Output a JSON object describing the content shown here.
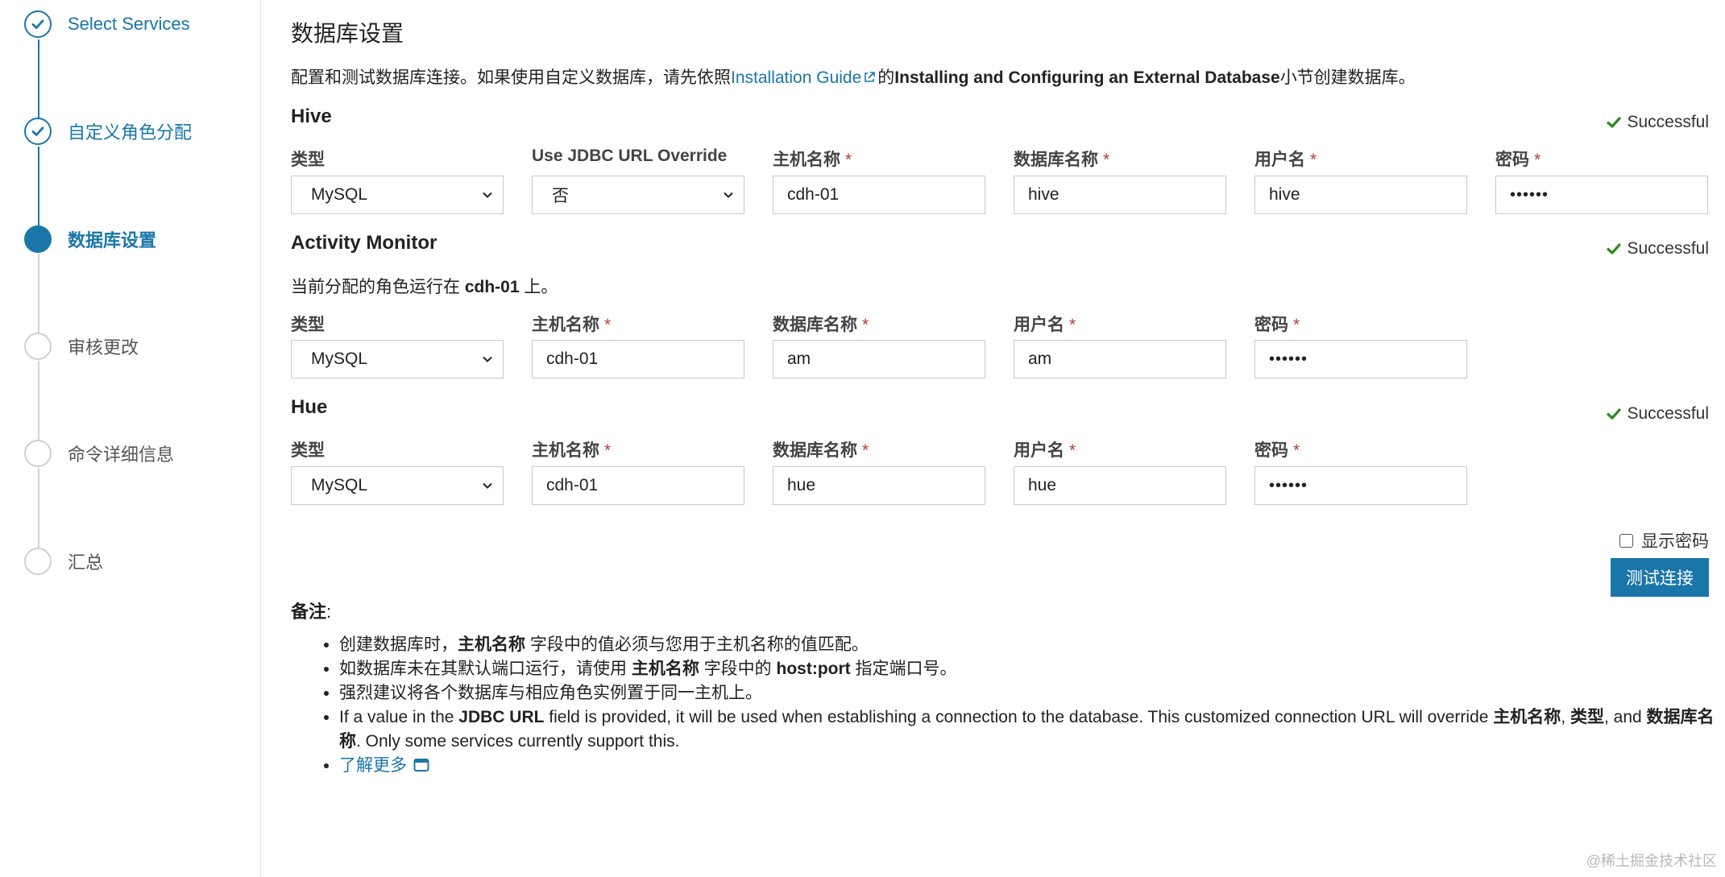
{
  "steps": [
    {
      "label": "Select Services",
      "state": "done"
    },
    {
      "label": "自定义角色分配",
      "state": "done"
    },
    {
      "label": "数据库设置",
      "state": "current"
    },
    {
      "label": "审核更改",
      "state": "todo"
    },
    {
      "label": "命令详细信息",
      "state": "todo"
    },
    {
      "label": "汇总",
      "state": "todo"
    }
  ],
  "page": {
    "title": "数据库设置",
    "intro_prefix": "配置和测试数据库连接。如果使用自定义数据库，请先依照",
    "intro_link": "Installation Guide",
    "intro_mid": "的",
    "intro_bold": "Installing and Configuring an External Database",
    "intro_suffix": "小节创建数据库。"
  },
  "hive": {
    "title": "Hive",
    "status": "Successful",
    "labels": {
      "type": "类型",
      "jdbc": "Use JDBC URL Override",
      "host": "主机名称",
      "db": "数据库名称",
      "user": "用户名",
      "pw": "密码"
    },
    "values": {
      "type": "MySQL",
      "jdbc": "否",
      "host": "cdh-01",
      "db": "hive",
      "user": "hive",
      "pw": "••••••"
    }
  },
  "am": {
    "title": "Activity Monitor",
    "status": "Successful",
    "note_prefix": "当前分配的角色运行在",
    "note_host": "cdh-01",
    "note_suffix": "上。",
    "labels": {
      "type": "类型",
      "host": "主机名称",
      "db": "数据库名称",
      "user": "用户名",
      "pw": "密码"
    },
    "values": {
      "type": "MySQL",
      "host": "cdh-01",
      "db": "am",
      "user": "am",
      "pw": "••••••"
    }
  },
  "hue": {
    "title": "Hue",
    "status": "Successful",
    "labels": {
      "type": "类型",
      "host": "主机名称",
      "db": "数据库名称",
      "user": "用户名",
      "pw": "密码"
    },
    "values": {
      "type": "MySQL",
      "host": "cdh-01",
      "db": "hue",
      "user": "hue",
      "pw": "••••••"
    }
  },
  "required_mark": "*",
  "show_password": "显示密码",
  "test_button": "测试连接",
  "notes": {
    "title": "备注",
    "n1_a": "创建数据库时，",
    "n1_b": "主机名称",
    "n1_c": "字段中的值必须与您用于主机名称的值匹配。",
    "n2_a": "如数据库未在其默认端口运行，请使用",
    "n2_b": "主机名称",
    "n2_c": "字段中的",
    "n2_d": "host:port",
    "n2_e": "指定端口号。",
    "n3": "强烈建议将各个数据库与相应角色实例置于同一主机上。",
    "n4_a": "If a value in the",
    "n4_b": "JDBC URL",
    "n4_c": "field is provided, it will be used when establishing a connection to the database. This customized connection URL will override",
    "n4_d": "主机名称",
    "n4_e": "类型",
    "n4_f": "and",
    "n4_g": "数据库名称",
    "n4_h": ". Only some services currently support this.",
    "learn_more": "了解更多"
  },
  "colors": {
    "accent": "#1a76a8",
    "success": "#2e8b1e",
    "required": "#c0392b"
  },
  "watermark": "@稀土掘金技术社区"
}
